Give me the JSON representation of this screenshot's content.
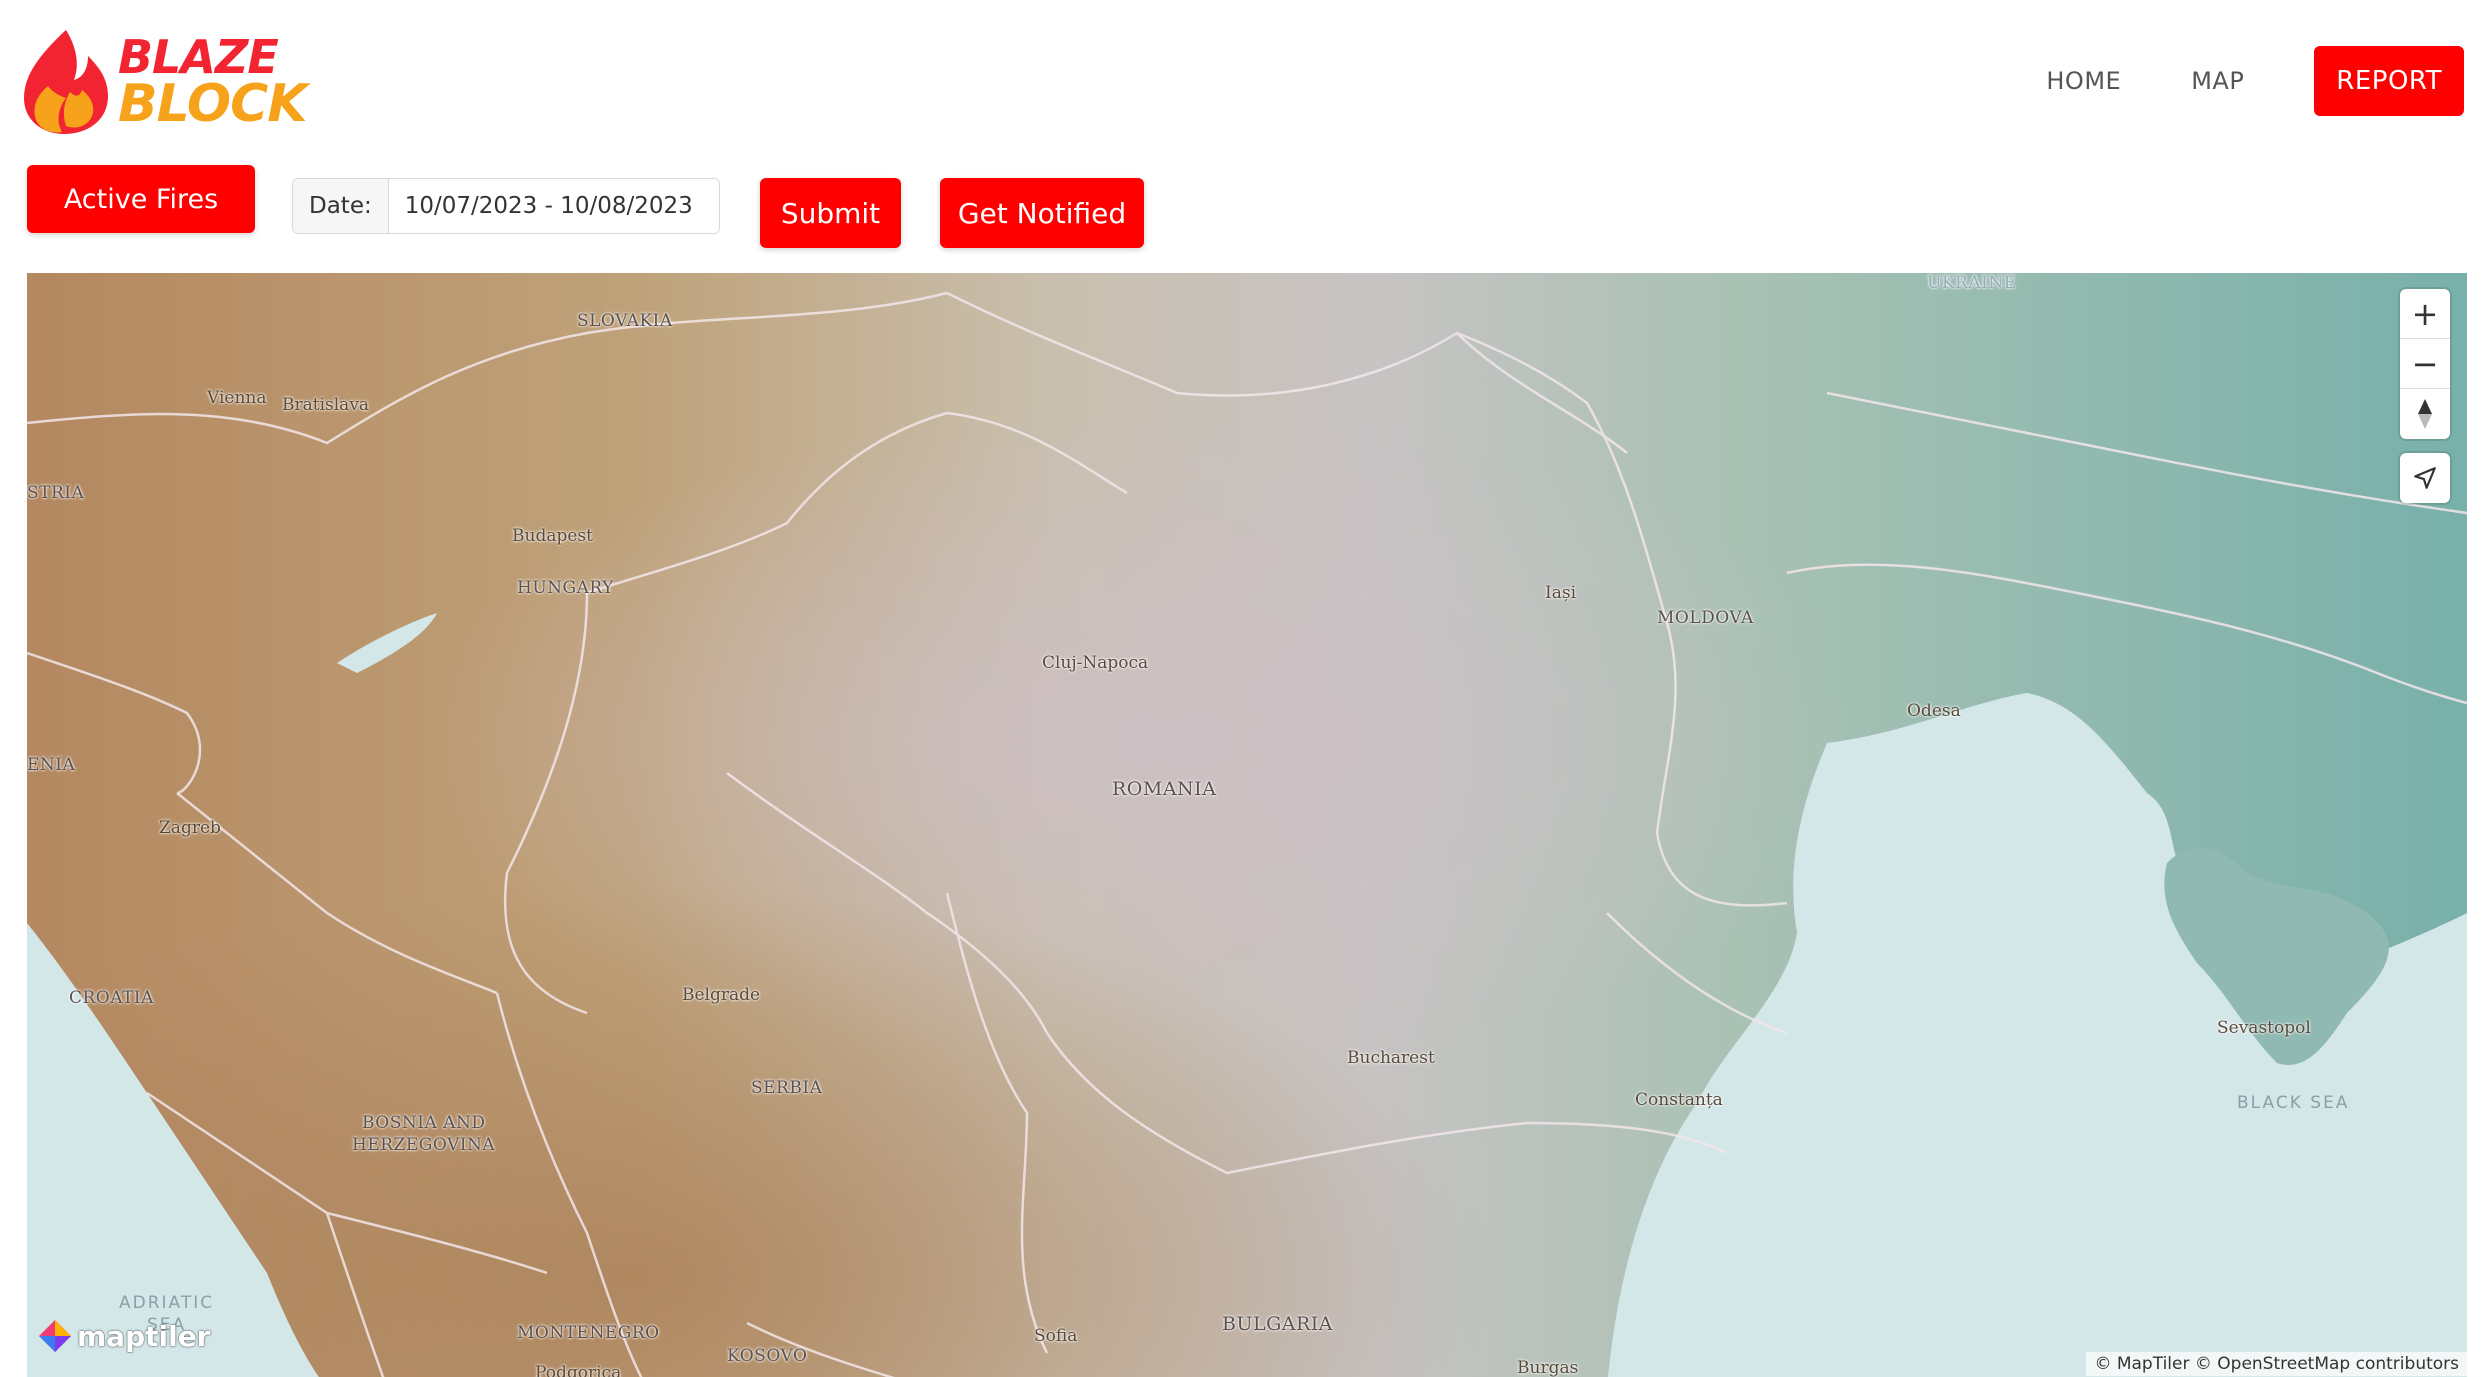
{
  "app": {
    "logo_line1": "BLAZE",
    "logo_line2": "BLOCK",
    "brand_red": "#ff0000",
    "brand_orange": "#f7a21b"
  },
  "nav": {
    "home": "HOME",
    "map": "MAP",
    "report": "REPORT"
  },
  "controls": {
    "active_fires": "Active Fires",
    "date_label": "Date:",
    "date_value": "10/07/2023 - 10/08/2023",
    "submit": "Submit",
    "get_notified": "Get Notified"
  },
  "map": {
    "zoom_in": "+",
    "zoom_out": "−",
    "attribution": "© MapTiler © OpenStreetMap contributors",
    "maptiler_logo": "maptiler",
    "labels": {
      "slovakia": "SLOVAKIA",
      "ukraine": "UKRAINE",
      "vienna": "Vienna",
      "bratislava": "Bratislava",
      "austria": "STRIA",
      "budapest": "Budapest",
      "hungary": "HUNGARY",
      "iasi": "Iași",
      "moldova": "MOLDOVA",
      "cluj": "Cluj-Napoca",
      "odesa": "Odesa",
      "romania": "ROMANIA",
      "slovenia": "ENIA",
      "zagreb": "Zagreb",
      "croatia": "CROATIA",
      "belgrade": "Belgrade",
      "bucharest": "Bucharest",
      "sevastopol": "Sevastopol",
      "serbia": "SERBIA",
      "constanta": "Constanța",
      "black_sea": "BLACK SEA",
      "bosnia1": "BOSNIA AND",
      "bosnia2": "HERZEGOVINA",
      "adriatic1": "ADRIATIC",
      "adriatic2": "SEA",
      "montenegro": "MONTENEGRO",
      "kosovo": "KOSOVO",
      "sofia": "Sofia",
      "bulgaria": "BULGARIA",
      "podgorica": "Podgorica",
      "burgas": "Burgas"
    }
  }
}
